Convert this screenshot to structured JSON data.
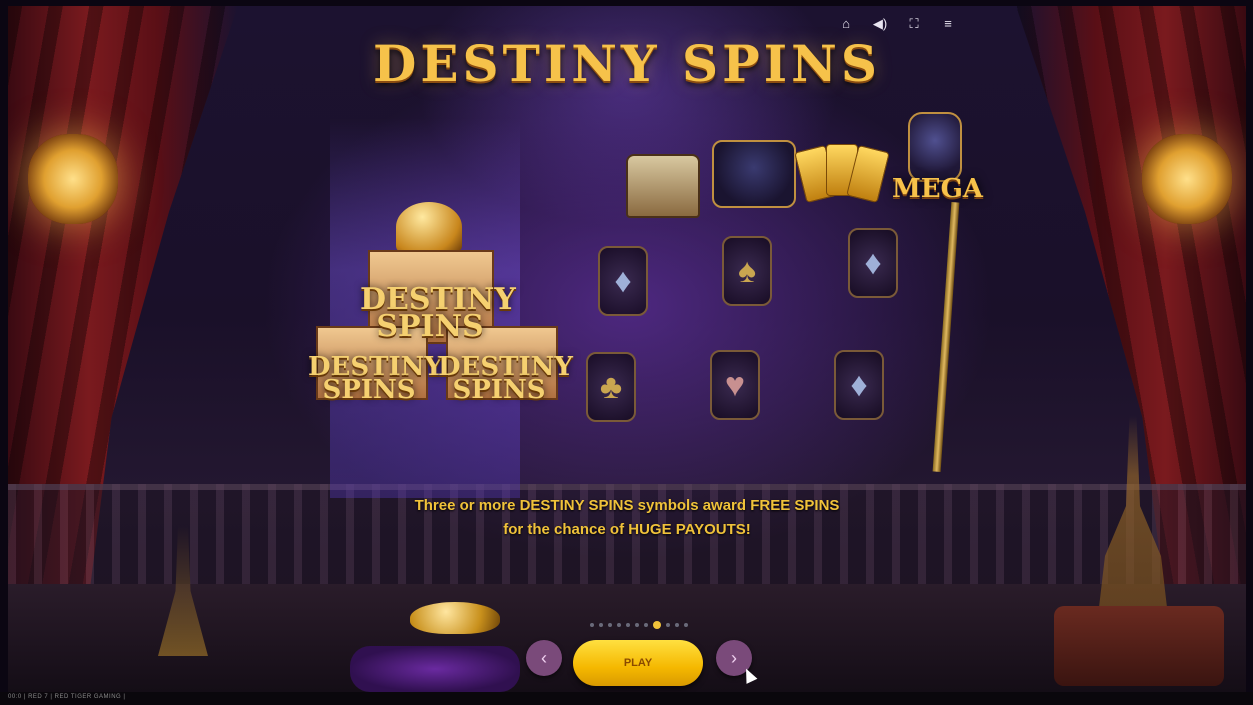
{
  "game": {
    "title": "DESTINY SPINS",
    "emblem": {
      "word_top_1": "DESTINY",
      "word_top_2": "SPINS",
      "word_left_1": "DESTINY",
      "word_left_2": "SPINS",
      "word_right_1": "DESTINY",
      "word_right_2": "SPINS"
    },
    "mega_label": "MEGA",
    "caption_line1": "Three or more DESTINY SPINS symbols award FREE SPINS",
    "caption_line2": "for the chance of HUGE PAYOUTS!"
  },
  "toolbar": {
    "icons": [
      "home-icon",
      "sound-icon",
      "fullscreen-icon",
      "menu-icon"
    ]
  },
  "controls": {
    "prev_label": "‹",
    "play_label": "PLAY",
    "next_label": "›",
    "page_dots_total": 11,
    "page_dots_active_index": 7
  },
  "footer": {
    "text": "00:0 | RED 7 | RED TIGER GAMING |"
  },
  "colors": {
    "title_gold": "#f6c24a",
    "caption_gold": "#f0c23a",
    "play_yellow": "#f5b800",
    "nav_purple": "#7a4a7a"
  }
}
